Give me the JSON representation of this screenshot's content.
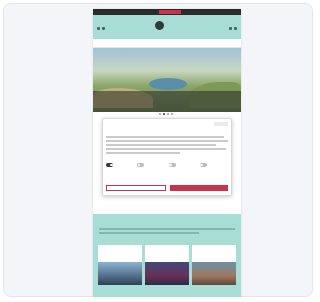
{
  "colors": {
    "accent": "#c8334e",
    "header_teal": "#a8ddd6",
    "topbar": "#2c2c2c"
  },
  "topbar": {
    "links": [
      "",
      "",
      "",
      "",
      ""
    ]
  },
  "header": {
    "logo_text": ""
  },
  "nav": {
    "items": [
      "",
      "",
      "",
      "",
      ""
    ]
  },
  "hero": {
    "kicker": "",
    "headline": "",
    "slide_index": 1,
    "slide_count": 4
  },
  "cookie_dialog": {
    "title": "",
    "brand": "",
    "categories": [
      {
        "label": "",
        "enabled": true
      },
      {
        "label": "",
        "enabled": false
      },
      {
        "label": "",
        "enabled": false
      },
      {
        "label": "",
        "enabled": false
      }
    ],
    "details_link": "",
    "decline_label": "",
    "accept_label": ""
  },
  "section": {
    "title": ""
  },
  "cards": [
    {
      "title": ""
    },
    {
      "title": ""
    },
    {
      "title": ""
    }
  ],
  "footer_title": ""
}
